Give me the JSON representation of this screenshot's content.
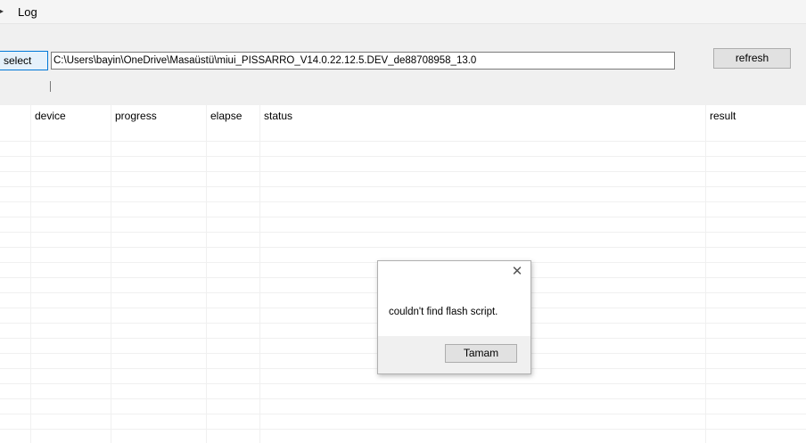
{
  "menubar": {
    "items": [
      "Log"
    ]
  },
  "toolbar": {
    "select_label": "select",
    "path_value": "C:\\Users\\bayin\\OneDrive\\Masaüstü\\miui_PISSARRO_V14.0.22.12.5.DEV_de88708958_13.0",
    "refresh_label": "refresh"
  },
  "table": {
    "columns": [
      "device",
      "progress",
      "elapse",
      "status",
      "result"
    ],
    "rows": []
  },
  "dialog": {
    "message": "couldn't find flash script.",
    "ok_label": "Tamam"
  },
  "icons": {
    "close": "close-icon",
    "menu": "chevron-icon"
  }
}
